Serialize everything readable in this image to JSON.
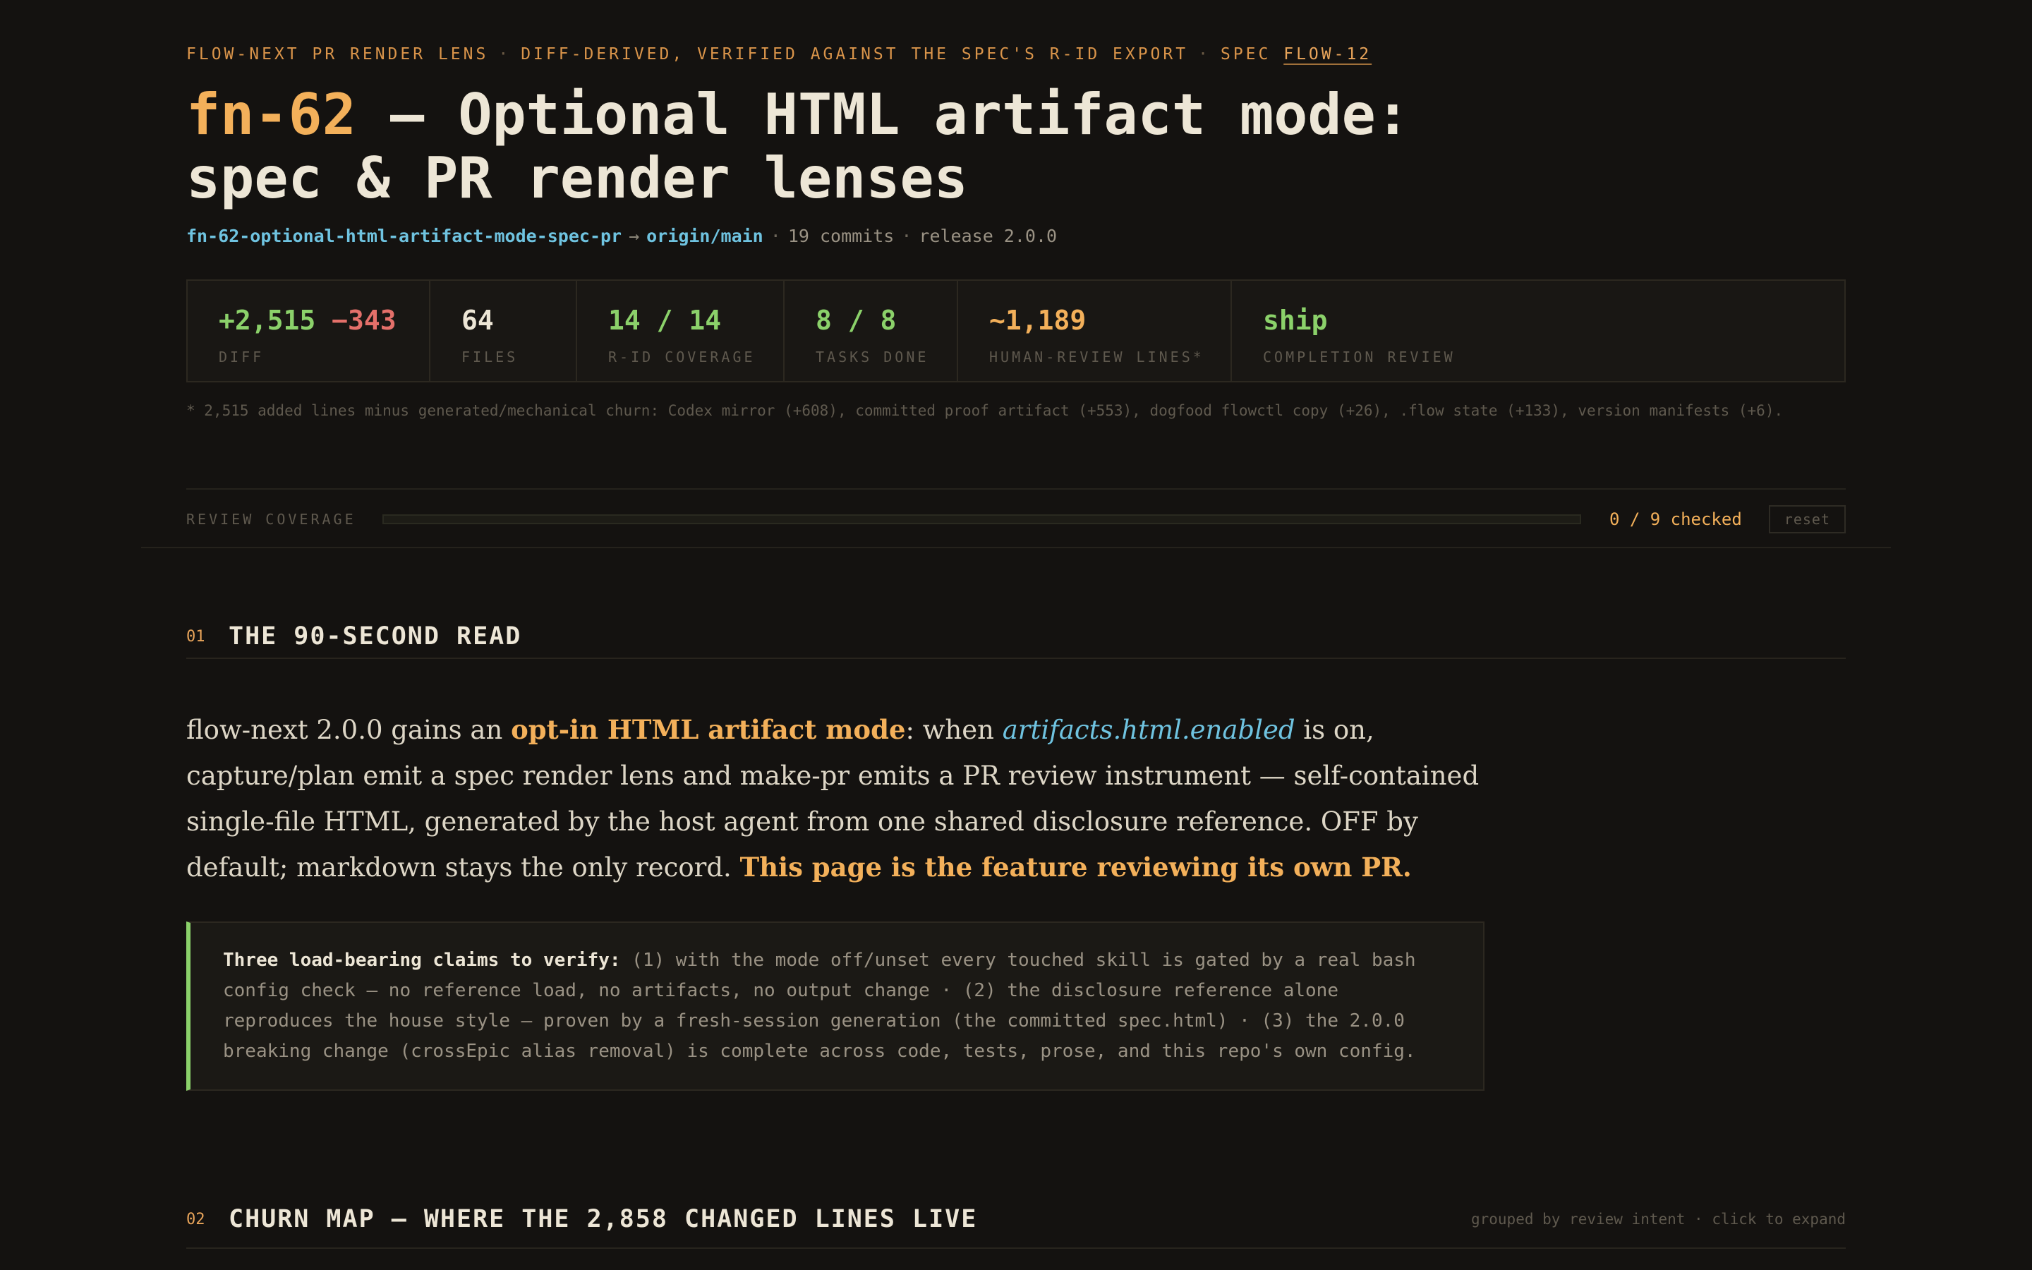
{
  "eyebrow": {
    "part1": "FLOW-NEXT PR RENDER LENS",
    "sep": "·",
    "part2": "DIFF-DERIVED, VERIFIED AGAINST THE SPEC'S R-ID EXPORT",
    "spec_prefix": "SPEC",
    "spec_link": "FLOW-12"
  },
  "title": {
    "id": "fn-62",
    "text": " — Optional HTML artifact mode: spec & PR render lenses"
  },
  "branch": {
    "head": "fn-62-optional-html-artifact-mode-spec-pr",
    "arrow": "→",
    "base": "origin/main",
    "sep": "·",
    "commits": "19 commits",
    "release": "release 2.0.0"
  },
  "stats": {
    "diff": {
      "added": "+2,515",
      "removed": "−343",
      "label": "DIFF"
    },
    "files": {
      "value": "64",
      "label": "FILES"
    },
    "rid": {
      "value": "14 / 14",
      "label": "R-ID COVERAGE"
    },
    "tasks": {
      "value": "8 / 8",
      "label": "TASKS DONE"
    },
    "human": {
      "value": "~1,189",
      "label": "HUMAN-REVIEW LINES*"
    },
    "review": {
      "value": "ship",
      "label": "COMPLETION REVIEW"
    }
  },
  "footnote": "* 2,515 added lines minus generated/mechanical churn: Codex mirror (+608), committed proof artifact (+553), dogfood flowctl copy (+26), .flow state (+133), version manifests (+6).",
  "coverage": {
    "label": "REVIEW COVERAGE",
    "checked": 0,
    "total": 9,
    "count_text": "0 / 9 checked",
    "reset_label": "reset"
  },
  "section1": {
    "num": "01",
    "title": "THE 90-SECOND READ",
    "lede": {
      "p1": "flow-next 2.0.0 gains an ",
      "hl1": "opt-in HTML artifact mode",
      "p2": ": when ",
      "code": "artifacts.html.enabled",
      "p3": " is on, capture/plan emit a spec render lens and make-pr emits a PR review instrument — self-contained single-file HTML, generated by the host agent from one shared disclosure reference. OFF by default; markdown stays the only record. ",
      "hl2": "This page is the feature reviewing its own PR."
    },
    "callout": {
      "lead": "Three load-bearing claims to verify:",
      "body": " (1) with the mode off/unset every touched skill is gated by a real bash config check — no reference load, no artifacts, no output change · (2) the disclosure reference alone reproduces the house style — proven by a fresh-session generation (the committed spec.html) · (3) the 2.0.0 breaking change (crossEpic alias removal) is complete across code, tests, prose, and this repo's own config."
    }
  },
  "section2": {
    "num": "02",
    "title": "CHURN MAP — WHERE THE 2,858 CHANGED LINES LIVE",
    "hint": "grouped by review intent · click to expand"
  },
  "colors": {
    "accent": "#f3b05a",
    "green": "#8bd16a",
    "red": "#e4706a",
    "link": "#6fc3e0",
    "background": "#141210"
  }
}
